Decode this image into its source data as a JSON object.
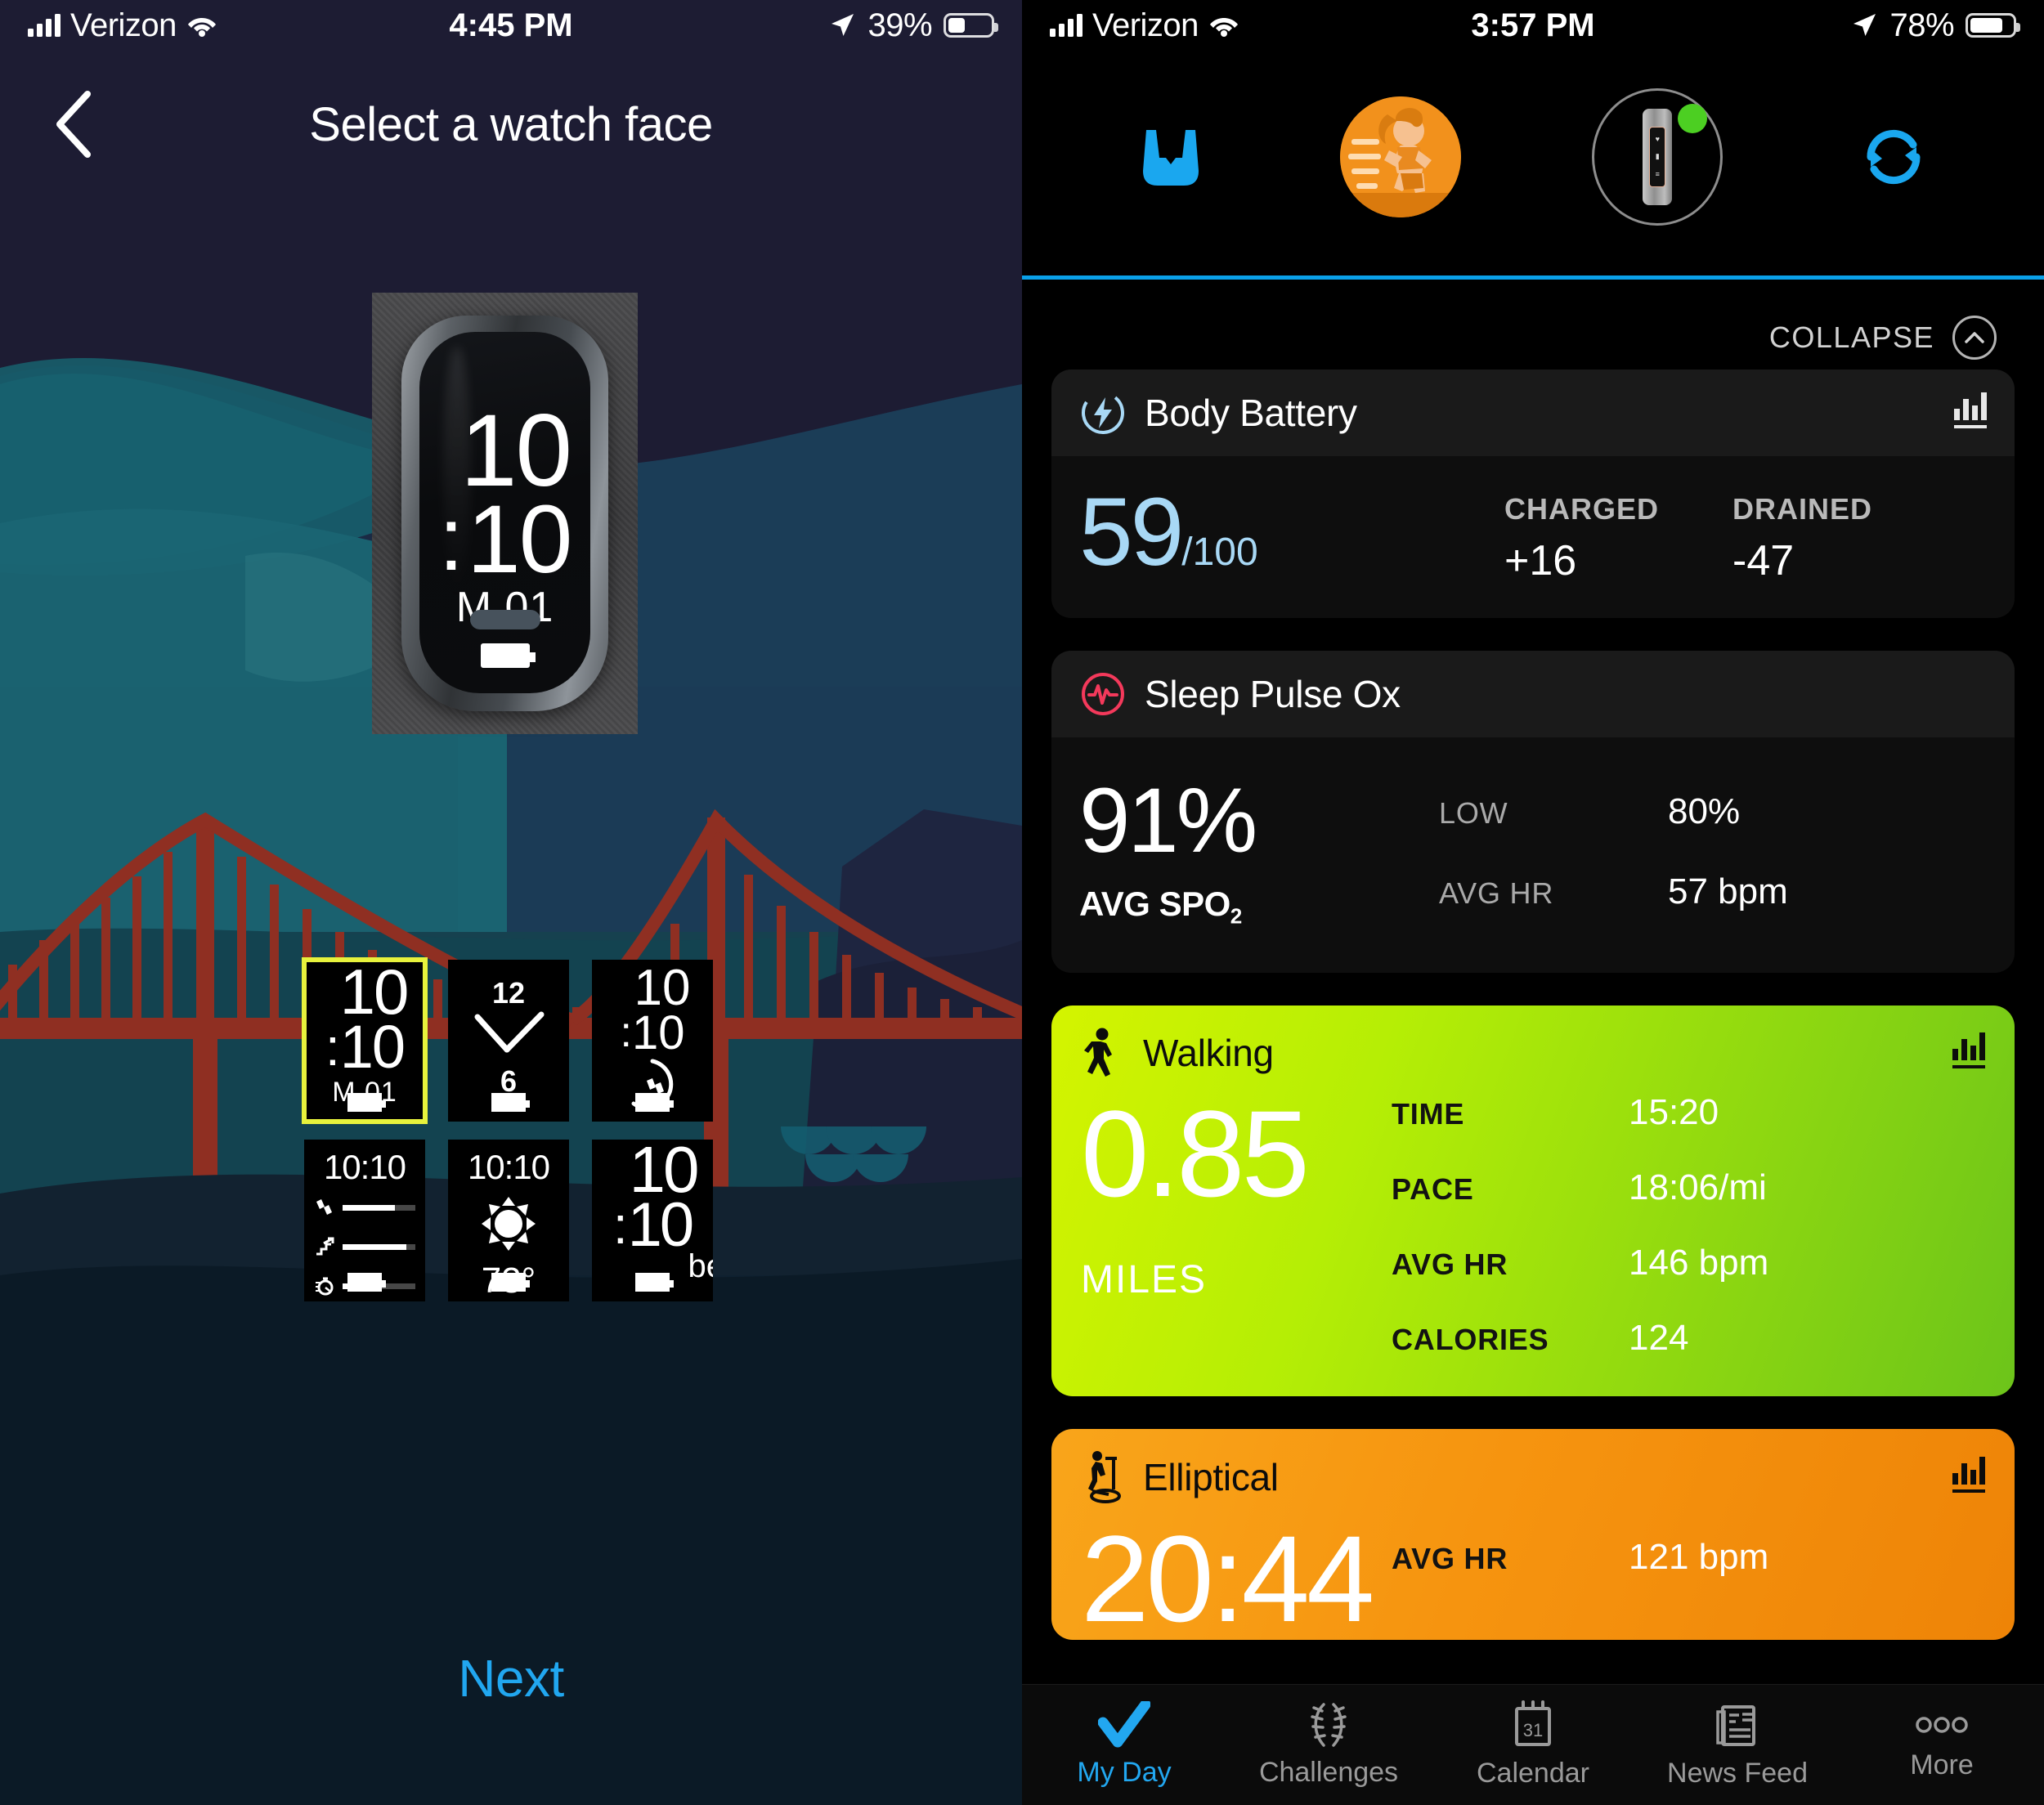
{
  "left": {
    "status": {
      "carrier": "Verizon",
      "time": "4:45 PM",
      "battery_percent": "39%",
      "wifi_icon": "wifi-icon",
      "location_icon": "location-arrow-icon",
      "signal_icon": "cellular-signal-icon"
    },
    "header": {
      "back_icon": "back-chevron-icon",
      "title": "Select a watch face"
    },
    "preview": {
      "hour": "10",
      "colon": ":",
      "minute": "10",
      "date": "M 01",
      "battery_icon": "battery-icon"
    },
    "faces": [
      {
        "id": "face-digital-big",
        "selected": true,
        "hour": "10",
        "colon": ":",
        "minute": "10",
        "date": "M 01",
        "battery_icon": "battery-icon"
      },
      {
        "id": "face-analog",
        "selected": false,
        "top_number": "12",
        "bottom_number": "6",
        "battery_icon": "battery-icon"
      },
      {
        "id": "face-steps-ring",
        "selected": false,
        "hour": "10",
        "colon": ":",
        "minute": "10",
        "ring_icon": "steps-ring-icon",
        "battery_icon": "battery-icon"
      },
      {
        "id": "face-three-metrics",
        "selected": false,
        "time": "10:10",
        "metrics": [
          {
            "icon": "footsteps-icon",
            "fill_percent": 72
          },
          {
            "icon": "floors-climbed-icon",
            "fill_percent": 88
          },
          {
            "icon": "intensity-minutes-icon",
            "fill_percent": 44
          }
        ],
        "battery_icon": "battery-icon"
      },
      {
        "id": "face-weather",
        "selected": false,
        "time": "10:10",
        "weather_icon": "sun-icon",
        "temperature": "73°",
        "battery_icon": "battery-icon"
      },
      {
        "id": "face-time-word",
        "selected": false,
        "hour": "10",
        "colon": ":",
        "minute": "10",
        "word": "be",
        "battery_icon": "battery-icon"
      }
    ],
    "next_label": "Next"
  },
  "right": {
    "status": {
      "carrier": "Verizon",
      "time": "3:57 PM",
      "battery_percent": "78%",
      "wifi_icon": "wifi-icon",
      "location_icon": "location-arrow-icon",
      "signal_icon": "cellular-signal-icon"
    },
    "topnav": [
      {
        "name": "inbox-icon",
        "label": "Inbox"
      },
      {
        "name": "profile-avatar",
        "label": "Profile"
      },
      {
        "name": "device-icon",
        "label": "Device"
      },
      {
        "name": "sync-icon",
        "label": "Sync"
      }
    ],
    "collapse": {
      "label": "COLLAPSE",
      "icon": "chevron-up-icon"
    },
    "cards": [
      {
        "id": "body-battery",
        "title": "Body Battery",
        "icon": "body-battery-icon",
        "icon_color": "#a8d8f5",
        "chart_icon": "bar-chart-icon",
        "value": "59",
        "unit": "/100",
        "stats": [
          {
            "label": "CHARGED",
            "value": "+16"
          },
          {
            "label": "DRAINED",
            "value": "-47"
          }
        ]
      },
      {
        "id": "sleep-pulse-ox",
        "title": "Sleep Pulse Ox",
        "icon": "pulse-ox-icon",
        "icon_color": "#f4395b",
        "value": "91%",
        "sub": "AVG SPO",
        "sub_sub": "2",
        "stats": [
          {
            "label": "LOW",
            "value": "80%"
          },
          {
            "label": "AVG HR",
            "value": "57 bpm"
          }
        ]
      },
      {
        "id": "walking",
        "title": "Walking",
        "icon": "walking-person-icon",
        "chart_icon": "bar-chart-icon",
        "value": "0.85",
        "sub": "MILES",
        "accent": "#b5ee05",
        "stats": [
          {
            "label": "TIME",
            "value": "15:20"
          },
          {
            "label": "PACE",
            "value": "18:06/mi"
          },
          {
            "label": "AVG HR",
            "value": "146 bpm"
          },
          {
            "label": "CALORIES",
            "value": "124"
          }
        ]
      },
      {
        "id": "elliptical",
        "title": "Elliptical",
        "icon": "elliptical-machine-icon",
        "chart_icon": "bar-chart-icon",
        "value": "20:44",
        "accent": "#f6940f",
        "stats": [
          {
            "label": "AVG HR",
            "value": "121 bpm"
          }
        ]
      }
    ],
    "tabs": [
      {
        "label": "My Day",
        "icon": "checkmark-icon",
        "active": true
      },
      {
        "label": "Challenges",
        "icon": "laurel-icon",
        "active": false
      },
      {
        "label": "Calendar",
        "icon": "calendar-icon",
        "active": false
      },
      {
        "label": "News Feed",
        "icon": "newspaper-icon",
        "active": false
      },
      {
        "label": "More",
        "icon": "ellipsis-icon",
        "active": false
      }
    ]
  }
}
